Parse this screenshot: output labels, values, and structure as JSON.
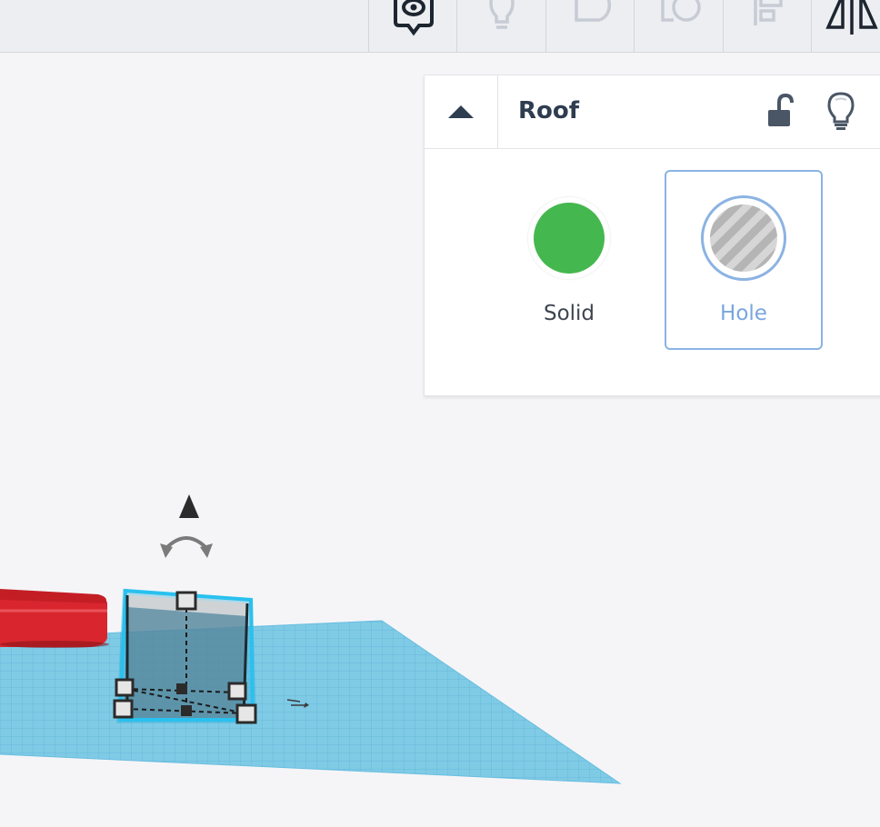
{
  "toolbar": {
    "tools": [
      {
        "name": "notes-tool",
        "icon": "eye-pin-icon"
      },
      {
        "name": "light-tool",
        "icon": "lightbulb-icon"
      },
      {
        "name": "group-tool",
        "icon": "group-shapes-icon"
      },
      {
        "name": "ungroup-tool",
        "icon": "ungroup-shapes-icon"
      },
      {
        "name": "align-tool",
        "icon": "align-icon"
      },
      {
        "name": "mirror-tool",
        "icon": "mirror-icon"
      }
    ]
  },
  "inspector": {
    "title": "Roof",
    "collapse_icon": "chevron-up-icon",
    "lock_icon": "unlock-icon",
    "light_icon": "lightbulb-icon",
    "options": {
      "solid": {
        "label": "Solid",
        "color": "#44b74e"
      },
      "hole": {
        "label": "Hole",
        "selected": true
      }
    }
  },
  "colors": {
    "accent": "#8bb3e3",
    "workplane": "#7ec8e3",
    "selected_shape_outline": "#29c1ef",
    "red_shape": "#d9262e"
  }
}
